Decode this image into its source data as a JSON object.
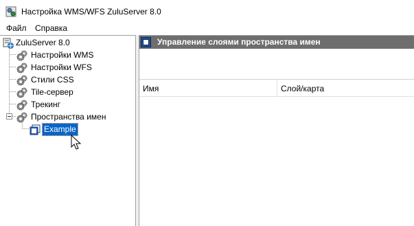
{
  "window": {
    "title": "Настройка WMS/WFS ZuluServer 8.0"
  },
  "menu": {
    "items": [
      {
        "label": "Файл"
      },
      {
        "label": "Справка"
      }
    ]
  },
  "tree": {
    "root": {
      "label": "ZuluServer 8.0",
      "icon": "server-globe-icon"
    },
    "items": [
      {
        "label": "Настройки WMS",
        "icon": "gears-icon"
      },
      {
        "label": "Настройки WFS",
        "icon": "gears-icon"
      },
      {
        "label": "Стили CSS",
        "icon": "gears-icon"
      },
      {
        "label": "Tile-сервер",
        "icon": "gears-icon"
      },
      {
        "label": "Трекинг",
        "icon": "gears-icon"
      },
      {
        "label": "Пространства имен",
        "icon": "gears-icon",
        "expanded": true
      }
    ],
    "namespace_children": [
      {
        "label": "Example",
        "icon": "layers-window-icon",
        "selected": true
      }
    ]
  },
  "panel": {
    "title": "Управление слоями пространства имен",
    "columns": [
      {
        "label": "Имя"
      },
      {
        "label": "Слой/карта"
      }
    ]
  },
  "colors": {
    "selection": "#0a64c8",
    "panel_header": "#6e6e6e"
  }
}
